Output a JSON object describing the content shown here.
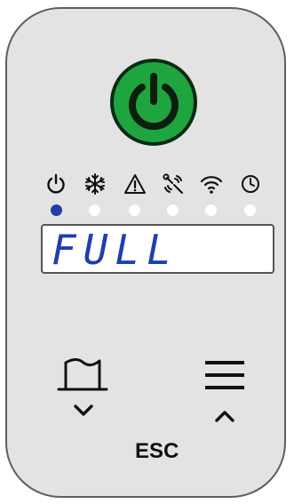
{
  "power_button": {
    "icon": "power-icon",
    "color": "#1fa53f"
  },
  "indicators": [
    {
      "icon": "power-icon",
      "active": true
    },
    {
      "icon": "snowflake-icon",
      "active": false
    },
    {
      "icon": "warning-icon",
      "active": false
    },
    {
      "icon": "fan-wrench-icon",
      "active": false
    },
    {
      "icon": "wifi-icon",
      "active": false
    },
    {
      "icon": "clock-icon",
      "active": false
    }
  ],
  "display": {
    "text": "FULL",
    "text_color": "#1f3fb0"
  },
  "buttons": {
    "left": {
      "icon": "door-icon",
      "arrow": "chevron-down-icon"
    },
    "right": {
      "icon": "menu-icon",
      "arrow": "chevron-up-icon"
    },
    "esc_label": "ESC"
  },
  "colors": {
    "panel": "#e3e3e4",
    "indicator_active": "#1e3fa6",
    "indicator_inactive": "#ffffff"
  }
}
